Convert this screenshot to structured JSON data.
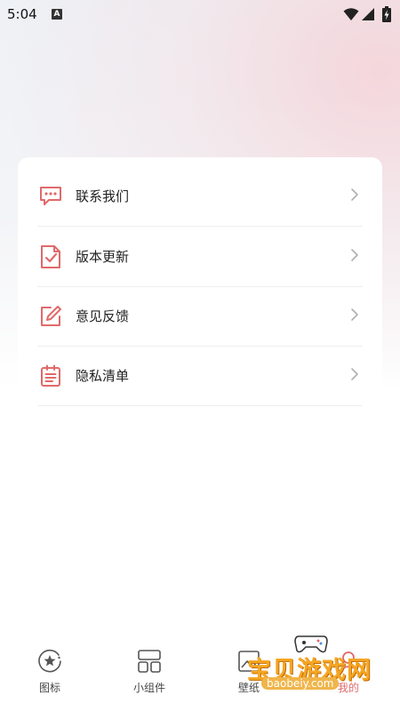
{
  "status_bar": {
    "time": "5:04",
    "notification_icon": "a-icon"
  },
  "menu": {
    "items": [
      {
        "label": "联系我们",
        "icon": "chat-bubble-icon"
      },
      {
        "label": "版本更新",
        "icon": "document-check-icon"
      },
      {
        "label": "意见反馈",
        "icon": "edit-icon"
      },
      {
        "label": "隐私清单",
        "icon": "list-icon"
      }
    ]
  },
  "tabbar": {
    "tabs": [
      {
        "label": "图标",
        "icon": "star-circle-icon"
      },
      {
        "label": "小组件",
        "icon": "widget-grid-icon"
      },
      {
        "label": "壁纸",
        "icon": "wallpaper-icon"
      },
      {
        "label": "我的",
        "icon": "profile-icon"
      }
    ]
  },
  "watermark": {
    "title": "宝贝游戏网",
    "url": "baobeiy.com"
  },
  "colors": {
    "accent": "#e06a6a",
    "text": "#222222",
    "divider": "#eeeeee"
  }
}
